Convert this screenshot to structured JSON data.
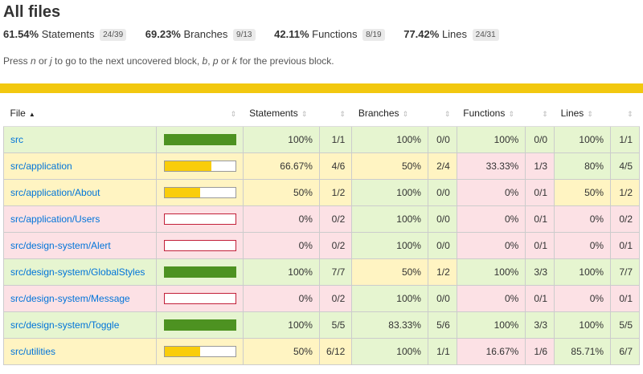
{
  "title": "All files",
  "summary": [
    {
      "pct": "61.54%",
      "label": "Statements",
      "frac": "24/39"
    },
    {
      "pct": "69.23%",
      "label": "Branches",
      "frac": "9/13"
    },
    {
      "pct": "42.11%",
      "label": "Functions",
      "frac": "8/19"
    },
    {
      "pct": "77.42%",
      "label": "Lines",
      "frac": "24/31"
    }
  ],
  "hint": {
    "p1": "Press ",
    "k1": "n",
    "p2": " or ",
    "k2": "j",
    "p3": " to go to the next uncovered block, ",
    "k3": "b",
    "p4": ", ",
    "k4": "p",
    "p5": " or ",
    "k5": "k",
    "p6": " for the previous block."
  },
  "columns": {
    "file": "File",
    "statements": "Statements",
    "branches": "Branches",
    "functions": "Functions",
    "lines": "Lines"
  },
  "colors": {
    "high": "#e6f5d0",
    "medium": "#fff4c2",
    "low": "#fce1e5",
    "bar_high": "#4d9221",
    "bar_medium": "#f9cd0b",
    "accent": "#f2c80f",
    "link": "#0074d9"
  },
  "rows": [
    {
      "file": "src",
      "coverage": 1.0,
      "level": "high",
      "statements": "100%",
      "statements_frac": "1/1",
      "st_level": "high",
      "branches": "100%",
      "branches_frac": "0/0",
      "br_level": "high",
      "functions": "100%",
      "functions_frac": "0/0",
      "fn_level": "high",
      "lines": "100%",
      "lines_frac": "1/1",
      "ln_level": "high"
    },
    {
      "file": "src/application",
      "coverage": 0.6667,
      "level": "medium",
      "statements": "66.67%",
      "statements_frac": "4/6",
      "st_level": "medium",
      "branches": "50%",
      "branches_frac": "2/4",
      "br_level": "medium",
      "functions": "33.33%",
      "functions_frac": "1/3",
      "fn_level": "low",
      "lines": "80%",
      "lines_frac": "4/5",
      "ln_level": "high"
    },
    {
      "file": "src/application/About",
      "coverage": 0.5,
      "level": "medium",
      "statements": "50%",
      "statements_frac": "1/2",
      "st_level": "medium",
      "branches": "100%",
      "branches_frac": "0/0",
      "br_level": "high",
      "functions": "0%",
      "functions_frac": "0/1",
      "fn_level": "low",
      "lines": "50%",
      "lines_frac": "1/2",
      "ln_level": "medium"
    },
    {
      "file": "src/application/Users",
      "coverage": 0,
      "level": "low",
      "statements": "0%",
      "statements_frac": "0/2",
      "st_level": "low",
      "branches": "100%",
      "branches_frac": "0/0",
      "br_level": "high",
      "functions": "0%",
      "functions_frac": "0/1",
      "fn_level": "low",
      "lines": "0%",
      "lines_frac": "0/2",
      "ln_level": "low"
    },
    {
      "file": "src/design-system/Alert",
      "coverage": 0,
      "level": "low",
      "statements": "0%",
      "statements_frac": "0/2",
      "st_level": "low",
      "branches": "100%",
      "branches_frac": "0/0",
      "br_level": "high",
      "functions": "0%",
      "functions_frac": "0/1",
      "fn_level": "low",
      "lines": "0%",
      "lines_frac": "0/1",
      "ln_level": "low"
    },
    {
      "file": "src/design-system/GlobalStyles",
      "coverage": 1.0,
      "level": "high",
      "statements": "100%",
      "statements_frac": "7/7",
      "st_level": "high",
      "branches": "50%",
      "branches_frac": "1/2",
      "br_level": "medium",
      "functions": "100%",
      "functions_frac": "3/3",
      "fn_level": "high",
      "lines": "100%",
      "lines_frac": "7/7",
      "ln_level": "high"
    },
    {
      "file": "src/design-system/Message",
      "coverage": 0,
      "level": "low",
      "statements": "0%",
      "statements_frac": "0/2",
      "st_level": "low",
      "branches": "100%",
      "branches_frac": "0/0",
      "br_level": "high",
      "functions": "0%",
      "functions_frac": "0/1",
      "fn_level": "low",
      "lines": "0%",
      "lines_frac": "0/1",
      "ln_level": "low"
    },
    {
      "file": "src/design-system/Toggle",
      "coverage": 1.0,
      "level": "high",
      "statements": "100%",
      "statements_frac": "5/5",
      "st_level": "high",
      "branches": "83.33%",
      "branches_frac": "5/6",
      "br_level": "high",
      "functions": "100%",
      "functions_frac": "3/3",
      "fn_level": "high",
      "lines": "100%",
      "lines_frac": "5/5",
      "ln_level": "high"
    },
    {
      "file": "src/utilities",
      "coverage": 0.5,
      "level": "medium",
      "statements": "50%",
      "statements_frac": "6/12",
      "st_level": "medium",
      "branches": "100%",
      "branches_frac": "1/1",
      "br_level": "high",
      "functions": "16.67%",
      "functions_frac": "1/6",
      "fn_level": "low",
      "lines": "85.71%",
      "lines_frac": "6/7",
      "ln_level": "high"
    }
  ]
}
